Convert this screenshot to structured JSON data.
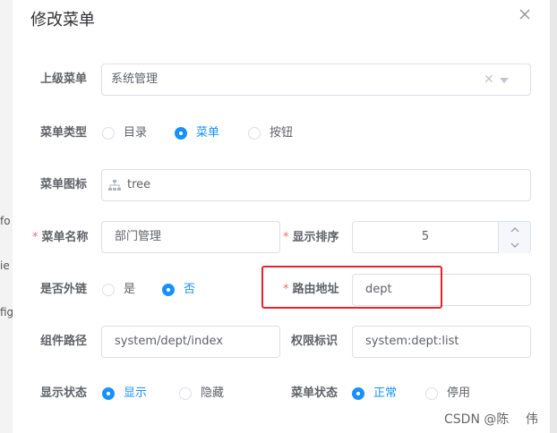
{
  "background": {
    "fragments": [
      "fo",
      "ie",
      "fig"
    ]
  },
  "dialog": {
    "title": "修改菜单",
    "close_icon": "close-icon"
  },
  "form": {
    "parent_menu": {
      "label": "上级菜单",
      "value": "系统管理"
    },
    "menu_type": {
      "label": "菜单类型",
      "options": [
        "目录",
        "菜单",
        "按钮"
      ],
      "selected": "菜单"
    },
    "menu_icon": {
      "label": "菜单图标",
      "icon": "tree-icon",
      "value": "tree"
    },
    "menu_name": {
      "label": "菜单名称",
      "required": "*",
      "value": "部门管理"
    },
    "order_num": {
      "label": "显示排序",
      "required": "*",
      "value": "5"
    },
    "is_frame": {
      "label": "是否外链",
      "options": [
        "是",
        "否"
      ],
      "selected": "否"
    },
    "route_path": {
      "label": "路由地址",
      "required": "*",
      "value": "dept"
    },
    "component": {
      "label": "组件路径",
      "value": "system/dept/index"
    },
    "perms": {
      "label": "权限标识",
      "value": "system:dept:list"
    },
    "visible": {
      "label": "显示状态",
      "options": [
        "显示",
        "隐藏"
      ],
      "selected": "显示"
    },
    "status": {
      "label": "菜单状态",
      "options": [
        "正常",
        "停用"
      ],
      "selected": "正常"
    }
  },
  "colors": {
    "primary": "#1890ff",
    "required": "#f56c6c",
    "highlight_box": "#e8222b",
    "border": "#dcdfe6"
  },
  "watermark": "CSDN @陈　 伟"
}
